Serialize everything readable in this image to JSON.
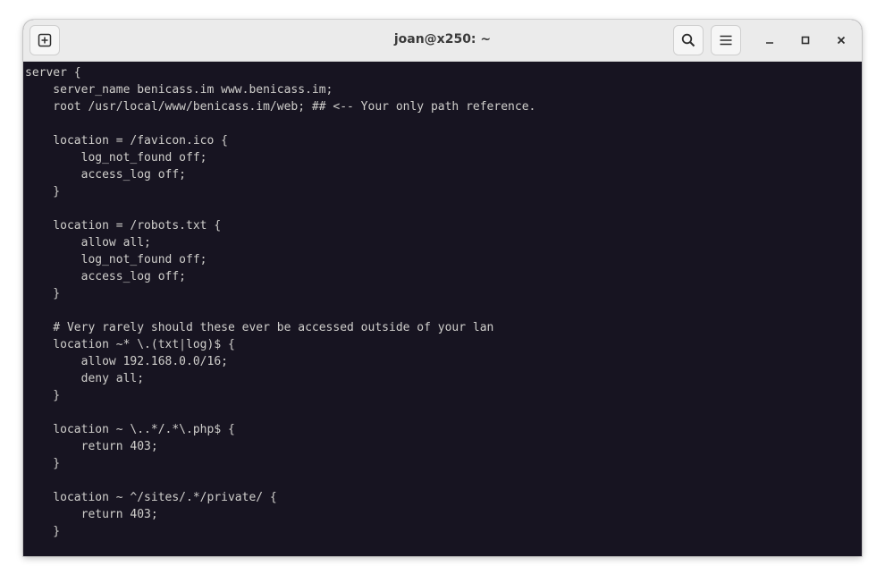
{
  "window": {
    "title": "joan@x250: ~"
  },
  "headerbar": {
    "new_tab_icon": "new-tab-icon",
    "search_icon": "search-icon",
    "menu_icon": "hamburger-menu-icon",
    "minimize_icon": "minimize-icon",
    "maximize_icon": "maximize-icon",
    "close_icon": "close-icon"
  },
  "terminal": {
    "background": "#171421",
    "foreground": "#d0cfcc",
    "lines": [
      "server {",
      "    server_name benicass.im www.benicass.im;",
      "    root /usr/local/www/benicass.im/web; ## <-- Your only path reference.",
      "",
      "    location = /favicon.ico {",
      "        log_not_found off;",
      "        access_log off;",
      "    }",
      "",
      "    location = /robots.txt {",
      "        allow all;",
      "        log_not_found off;",
      "        access_log off;",
      "    }",
      "",
      "    # Very rarely should these ever be accessed outside of your lan",
      "    location ~* \\.(txt|log)$ {",
      "        allow 192.168.0.0/16;",
      "        deny all;",
      "    }",
      "",
      "    location ~ \\..*/.*\\.php$ {",
      "        return 403;",
      "    }",
      "",
      "    location ~ ^/sites/.*/private/ {",
      "        return 403;",
      "    }"
    ]
  }
}
